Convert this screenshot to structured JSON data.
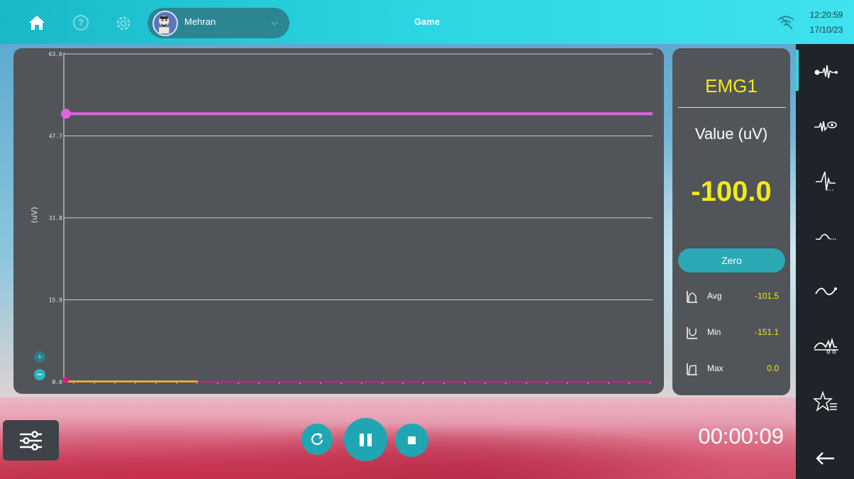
{
  "header": {
    "title": "Game",
    "user_name": "Mehran",
    "time": "12:20:59",
    "date": "17/10/23"
  },
  "chart_data": {
    "type": "line",
    "ylabel": "(uV)",
    "y_ticks": [
      "63.6",
      "47.7",
      "31.8",
      "15.9",
      "0.0"
    ],
    "ylim": [
      0,
      63.6
    ],
    "grid": true,
    "series": [
      {
        "name": "",
        "color": "#e262e0",
        "values": [
          52.0,
          52.0
        ]
      },
      {
        "name": "",
        "color": "#f3c21d",
        "values": [
          0.0,
          0.0
        ]
      },
      {
        "name": "",
        "color": "#e0158b",
        "values": [
          0.0,
          0.0
        ]
      }
    ]
  },
  "stats": {
    "channel": "EMG1",
    "value_label": "Value (uV)",
    "value": "-100.0",
    "zero_label": "Zero",
    "rows": [
      {
        "icon": "avg-icon",
        "label": "Avg",
        "value": "-101.5"
      },
      {
        "icon": "min-icon",
        "label": "Min",
        "value": "-151.1"
      },
      {
        "icon": "max-icon",
        "label": "Max",
        "value": "0.0"
      }
    ]
  },
  "controls": {
    "timer": "00:00:09"
  },
  "zoom": {
    "plus": "+",
    "minus": "−"
  },
  "colors": {
    "accent": "#20a6b3",
    "value_yellow": "#f1ea1e"
  }
}
